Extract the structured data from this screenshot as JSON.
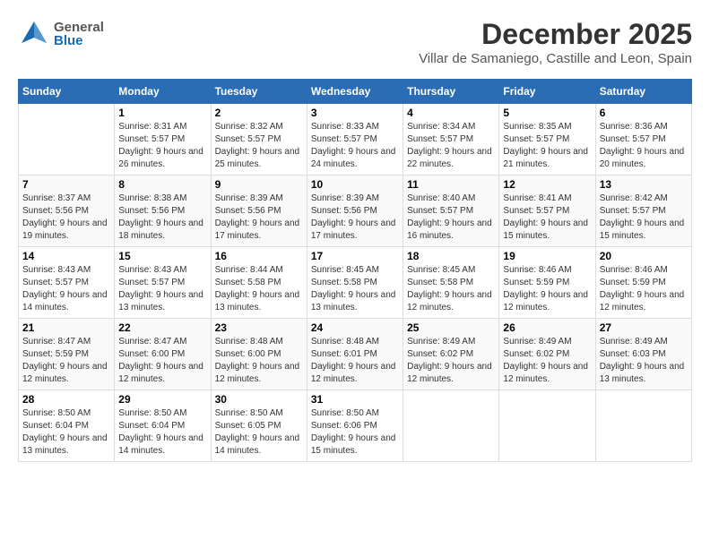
{
  "header": {
    "logo_general": "General",
    "logo_blue": "Blue",
    "month_title": "December 2025",
    "subtitle": "Villar de Samaniego, Castille and Leon, Spain"
  },
  "weekdays": [
    "Sunday",
    "Monday",
    "Tuesday",
    "Wednesday",
    "Thursday",
    "Friday",
    "Saturday"
  ],
  "weeks": [
    [
      {
        "day": "",
        "sunrise": "",
        "sunset": "",
        "daylight": ""
      },
      {
        "day": "1",
        "sunrise": "Sunrise: 8:31 AM",
        "sunset": "Sunset: 5:57 PM",
        "daylight": "Daylight: 9 hours and 26 minutes."
      },
      {
        "day": "2",
        "sunrise": "Sunrise: 8:32 AM",
        "sunset": "Sunset: 5:57 PM",
        "daylight": "Daylight: 9 hours and 25 minutes."
      },
      {
        "day": "3",
        "sunrise": "Sunrise: 8:33 AM",
        "sunset": "Sunset: 5:57 PM",
        "daylight": "Daylight: 9 hours and 24 minutes."
      },
      {
        "day": "4",
        "sunrise": "Sunrise: 8:34 AM",
        "sunset": "Sunset: 5:57 PM",
        "daylight": "Daylight: 9 hours and 22 minutes."
      },
      {
        "day": "5",
        "sunrise": "Sunrise: 8:35 AM",
        "sunset": "Sunset: 5:57 PM",
        "daylight": "Daylight: 9 hours and 21 minutes."
      },
      {
        "day": "6",
        "sunrise": "Sunrise: 8:36 AM",
        "sunset": "Sunset: 5:57 PM",
        "daylight": "Daylight: 9 hours and 20 minutes."
      }
    ],
    [
      {
        "day": "7",
        "sunrise": "Sunrise: 8:37 AM",
        "sunset": "Sunset: 5:56 PM",
        "daylight": "Daylight: 9 hours and 19 minutes."
      },
      {
        "day": "8",
        "sunrise": "Sunrise: 8:38 AM",
        "sunset": "Sunset: 5:56 PM",
        "daylight": "Daylight: 9 hours and 18 minutes."
      },
      {
        "day": "9",
        "sunrise": "Sunrise: 8:39 AM",
        "sunset": "Sunset: 5:56 PM",
        "daylight": "Daylight: 9 hours and 17 minutes."
      },
      {
        "day": "10",
        "sunrise": "Sunrise: 8:39 AM",
        "sunset": "Sunset: 5:56 PM",
        "daylight": "Daylight: 9 hours and 17 minutes."
      },
      {
        "day": "11",
        "sunrise": "Sunrise: 8:40 AM",
        "sunset": "Sunset: 5:57 PM",
        "daylight": "Daylight: 9 hours and 16 minutes."
      },
      {
        "day": "12",
        "sunrise": "Sunrise: 8:41 AM",
        "sunset": "Sunset: 5:57 PM",
        "daylight": "Daylight: 9 hours and 15 minutes."
      },
      {
        "day": "13",
        "sunrise": "Sunrise: 8:42 AM",
        "sunset": "Sunset: 5:57 PM",
        "daylight": "Daylight: 9 hours and 15 minutes."
      }
    ],
    [
      {
        "day": "14",
        "sunrise": "Sunrise: 8:43 AM",
        "sunset": "Sunset: 5:57 PM",
        "daylight": "Daylight: 9 hours and 14 minutes."
      },
      {
        "day": "15",
        "sunrise": "Sunrise: 8:43 AM",
        "sunset": "Sunset: 5:57 PM",
        "daylight": "Daylight: 9 hours and 13 minutes."
      },
      {
        "day": "16",
        "sunrise": "Sunrise: 8:44 AM",
        "sunset": "Sunset: 5:58 PM",
        "daylight": "Daylight: 9 hours and 13 minutes."
      },
      {
        "day": "17",
        "sunrise": "Sunrise: 8:45 AM",
        "sunset": "Sunset: 5:58 PM",
        "daylight": "Daylight: 9 hours and 13 minutes."
      },
      {
        "day": "18",
        "sunrise": "Sunrise: 8:45 AM",
        "sunset": "Sunset: 5:58 PM",
        "daylight": "Daylight: 9 hours and 12 minutes."
      },
      {
        "day": "19",
        "sunrise": "Sunrise: 8:46 AM",
        "sunset": "Sunset: 5:59 PM",
        "daylight": "Daylight: 9 hours and 12 minutes."
      },
      {
        "day": "20",
        "sunrise": "Sunrise: 8:46 AM",
        "sunset": "Sunset: 5:59 PM",
        "daylight": "Daylight: 9 hours and 12 minutes."
      }
    ],
    [
      {
        "day": "21",
        "sunrise": "Sunrise: 8:47 AM",
        "sunset": "Sunset: 5:59 PM",
        "daylight": "Daylight: 9 hours and 12 minutes."
      },
      {
        "day": "22",
        "sunrise": "Sunrise: 8:47 AM",
        "sunset": "Sunset: 6:00 PM",
        "daylight": "Daylight: 9 hours and 12 minutes."
      },
      {
        "day": "23",
        "sunrise": "Sunrise: 8:48 AM",
        "sunset": "Sunset: 6:00 PM",
        "daylight": "Daylight: 9 hours and 12 minutes."
      },
      {
        "day": "24",
        "sunrise": "Sunrise: 8:48 AM",
        "sunset": "Sunset: 6:01 PM",
        "daylight": "Daylight: 9 hours and 12 minutes."
      },
      {
        "day": "25",
        "sunrise": "Sunrise: 8:49 AM",
        "sunset": "Sunset: 6:02 PM",
        "daylight": "Daylight: 9 hours and 12 minutes."
      },
      {
        "day": "26",
        "sunrise": "Sunrise: 8:49 AM",
        "sunset": "Sunset: 6:02 PM",
        "daylight": "Daylight: 9 hours and 12 minutes."
      },
      {
        "day": "27",
        "sunrise": "Sunrise: 8:49 AM",
        "sunset": "Sunset: 6:03 PM",
        "daylight": "Daylight: 9 hours and 13 minutes."
      }
    ],
    [
      {
        "day": "28",
        "sunrise": "Sunrise: 8:50 AM",
        "sunset": "Sunset: 6:04 PM",
        "daylight": "Daylight: 9 hours and 13 minutes."
      },
      {
        "day": "29",
        "sunrise": "Sunrise: 8:50 AM",
        "sunset": "Sunset: 6:04 PM",
        "daylight": "Daylight: 9 hours and 14 minutes."
      },
      {
        "day": "30",
        "sunrise": "Sunrise: 8:50 AM",
        "sunset": "Sunset: 6:05 PM",
        "daylight": "Daylight: 9 hours and 14 minutes."
      },
      {
        "day": "31",
        "sunrise": "Sunrise: 8:50 AM",
        "sunset": "Sunset: 6:06 PM",
        "daylight": "Daylight: 9 hours and 15 minutes."
      },
      {
        "day": "",
        "sunrise": "",
        "sunset": "",
        "daylight": ""
      },
      {
        "day": "",
        "sunrise": "",
        "sunset": "",
        "daylight": ""
      },
      {
        "day": "",
        "sunrise": "",
        "sunset": "",
        "daylight": ""
      }
    ]
  ]
}
